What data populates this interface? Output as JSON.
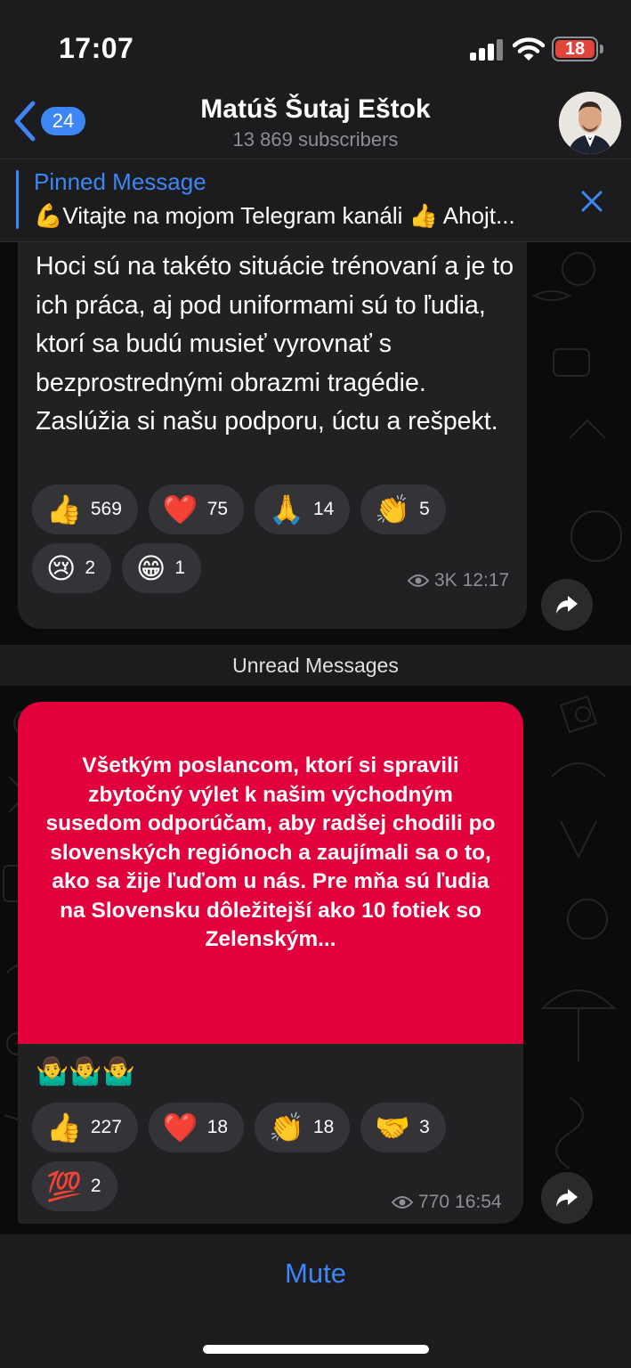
{
  "status_bar": {
    "time": "17:07",
    "battery": "18",
    "battery_color": "#e0443b"
  },
  "header": {
    "back_count": "24",
    "title": "Matúš Šutaj Eštok",
    "subtitle": "13 869 subscribers"
  },
  "pinned": {
    "title": "Pinned Message",
    "text": "💪Vitajte na mojom Telegram kanáli 👍 Ahojt..."
  },
  "messages": [
    {
      "text": "Hoci sú na takéto situácie trénovaní a je to ich práca, aj pod uniformami sú to ľudia, ktorí sa budú musieť vyrovnať s bezprostrednými obrazmi tragédie. Zaslúžia si našu podporu, úctu a rešpekt.",
      "reactions": [
        {
          "emoji": "👍",
          "count": "569"
        },
        {
          "emoji": "❤️",
          "count": "75"
        },
        {
          "emoji": "🙏",
          "count": "14"
        },
        {
          "emoji": "👏",
          "count": "5"
        },
        {
          "emoji": "😢",
          "count": "2"
        },
        {
          "emoji": "😁",
          "count": "1"
        }
      ],
      "views": "3K",
      "time": "12:17"
    },
    {
      "image_text": "Všetkým poslancom, ktorí si spravili zbytočný výlet k našim východným susedom odporúčam, aby radšej chodili po slovenských regiónoch a zaujímali sa o to, ako sa žije ľuďom u nás. Pre mňa sú ľudia na Slovensku dôležitejší ako 10 fotiek so Zelenským...",
      "caption": "🤷‍♂️🤷‍♂️🤷‍♂️",
      "reactions": [
        {
          "emoji": "👍",
          "count": "227"
        },
        {
          "emoji": "❤️",
          "count": "18"
        },
        {
          "emoji": "👏",
          "count": "18"
        },
        {
          "emoji": "🤝",
          "count": "3"
        },
        {
          "emoji": "💯",
          "count": "2"
        }
      ],
      "views": "770",
      "time": "16:54"
    }
  ],
  "unread_label": "Unread Messages",
  "bottom": {
    "mute_label": "Mute"
  },
  "colors": {
    "accent": "#3e86f5",
    "image_bg": "#e1003c",
    "bubble": "#212123"
  }
}
